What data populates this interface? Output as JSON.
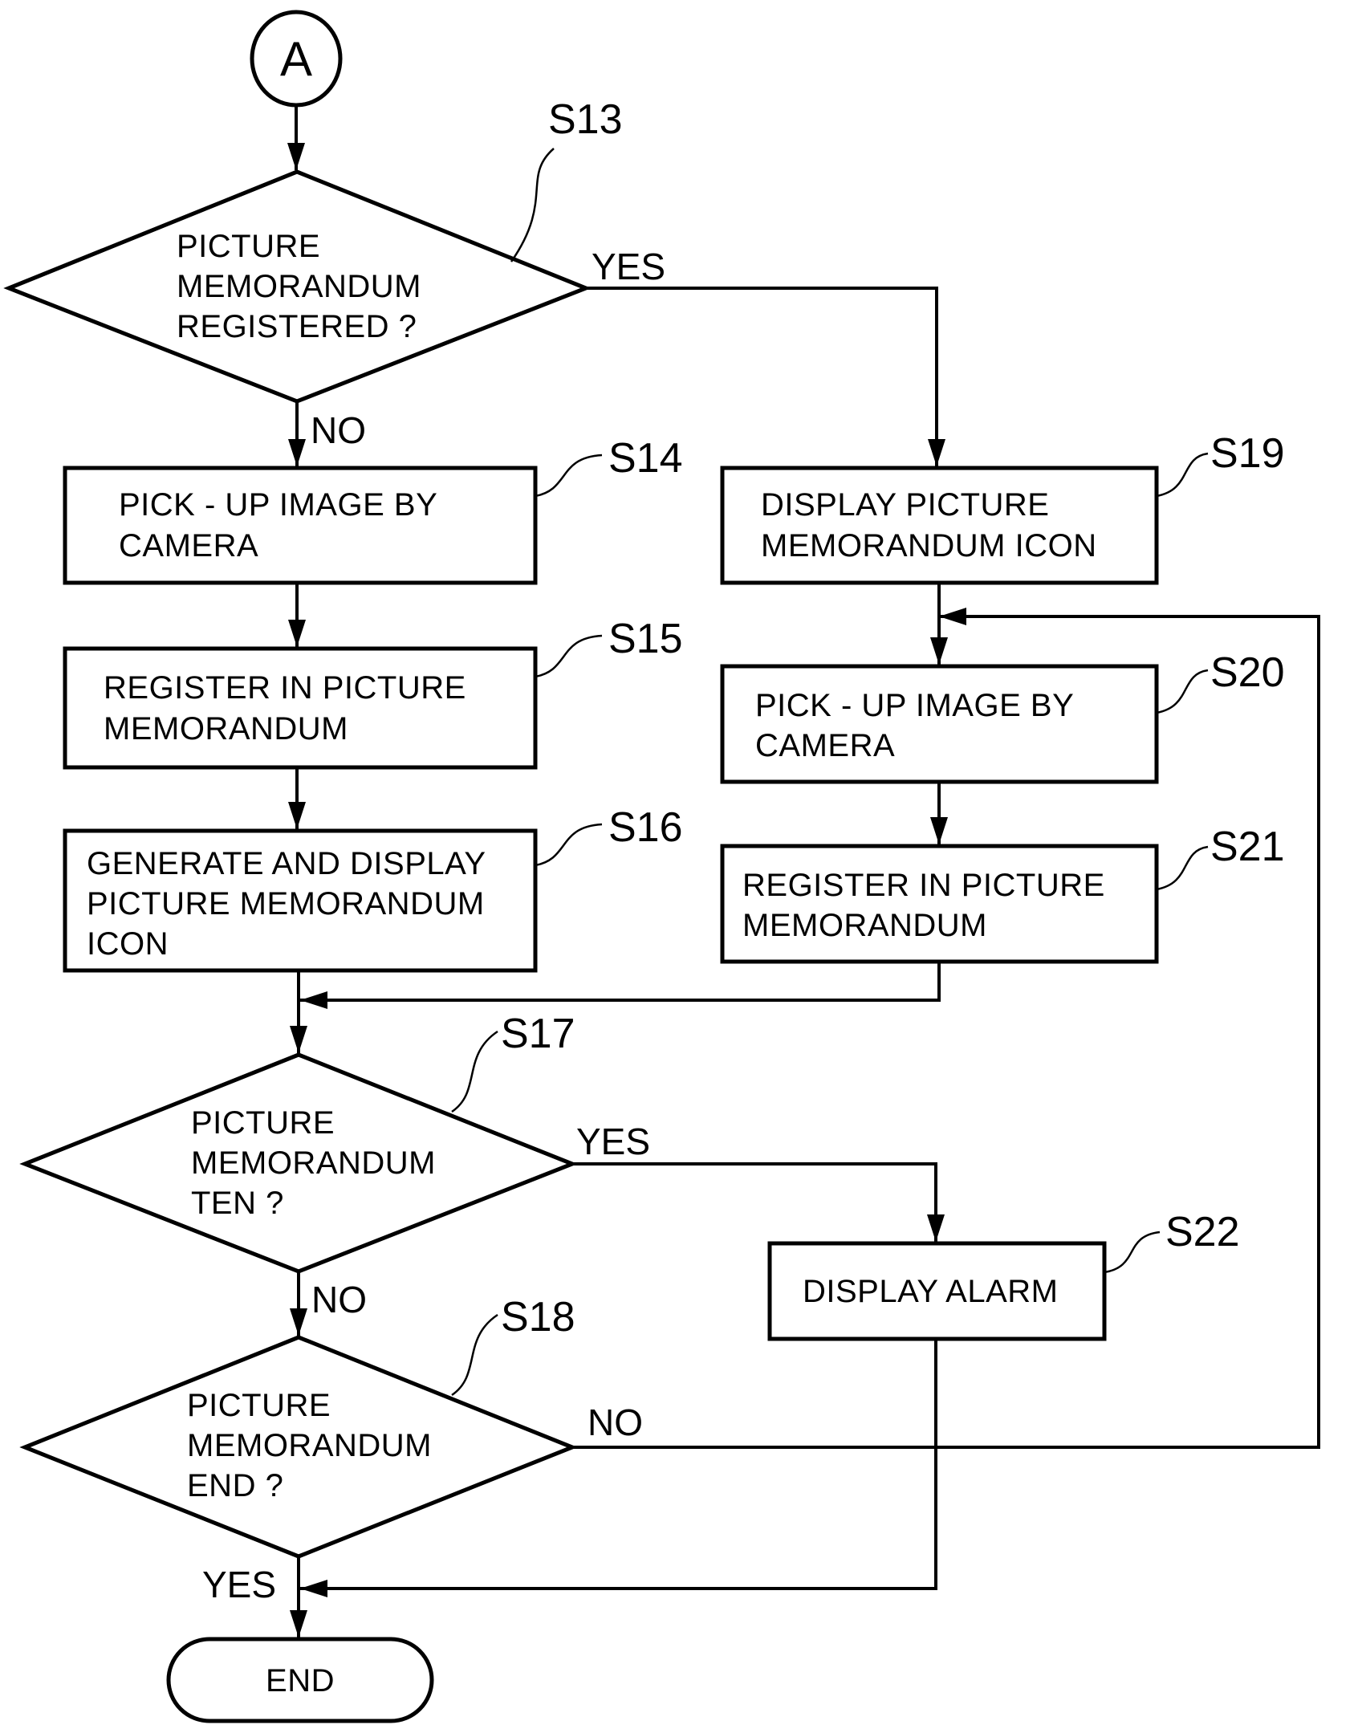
{
  "figure": {
    "connector_in": "A",
    "steps": {
      "s13": {
        "id": "S13",
        "type": "decision",
        "lines": [
          "PICTURE",
          "MEMORANDUM",
          "REGISTERED ?"
        ],
        "yes": "YES",
        "no": "NO"
      },
      "s14": {
        "id": "S14",
        "type": "process",
        "lines": [
          "PICK - UP  IMAGE  BY",
          "CAMERA"
        ]
      },
      "s15": {
        "id": "S15",
        "type": "process",
        "lines": [
          "REGISTER  IN  PICTURE",
          "MEMORANDUM"
        ]
      },
      "s16": {
        "id": "S16",
        "type": "process",
        "lines": [
          "GENERATE  AND  DISPLAY",
          "PICTURE  MEMORANDUM",
          "ICON"
        ]
      },
      "s17": {
        "id": "S17",
        "type": "decision",
        "lines": [
          "PICTURE",
          "MEMORANDUM",
          "TEN ?"
        ],
        "yes": "YES",
        "no": "NO"
      },
      "s18": {
        "id": "S18",
        "type": "decision",
        "lines": [
          "PICTURE",
          "MEMORANDUM",
          "END ?"
        ],
        "yes": "YES",
        "no": "NO"
      },
      "s19": {
        "id": "S19",
        "type": "process",
        "lines": [
          "DISPLAY  PICTURE",
          "MEMORANDUM  ICON"
        ]
      },
      "s20": {
        "id": "S20",
        "type": "process",
        "lines": [
          "PICK - UP  IMAGE  BY",
          "CAMERA"
        ]
      },
      "s21": {
        "id": "S21",
        "type": "process",
        "lines": [
          "REGISTER  IN  PICTURE",
          "MEMORANDUM"
        ]
      },
      "s22": {
        "id": "S22",
        "type": "process",
        "lines": [
          "DISPLAY  ALARM"
        ]
      }
    },
    "terminal": {
      "label": "END"
    }
  }
}
